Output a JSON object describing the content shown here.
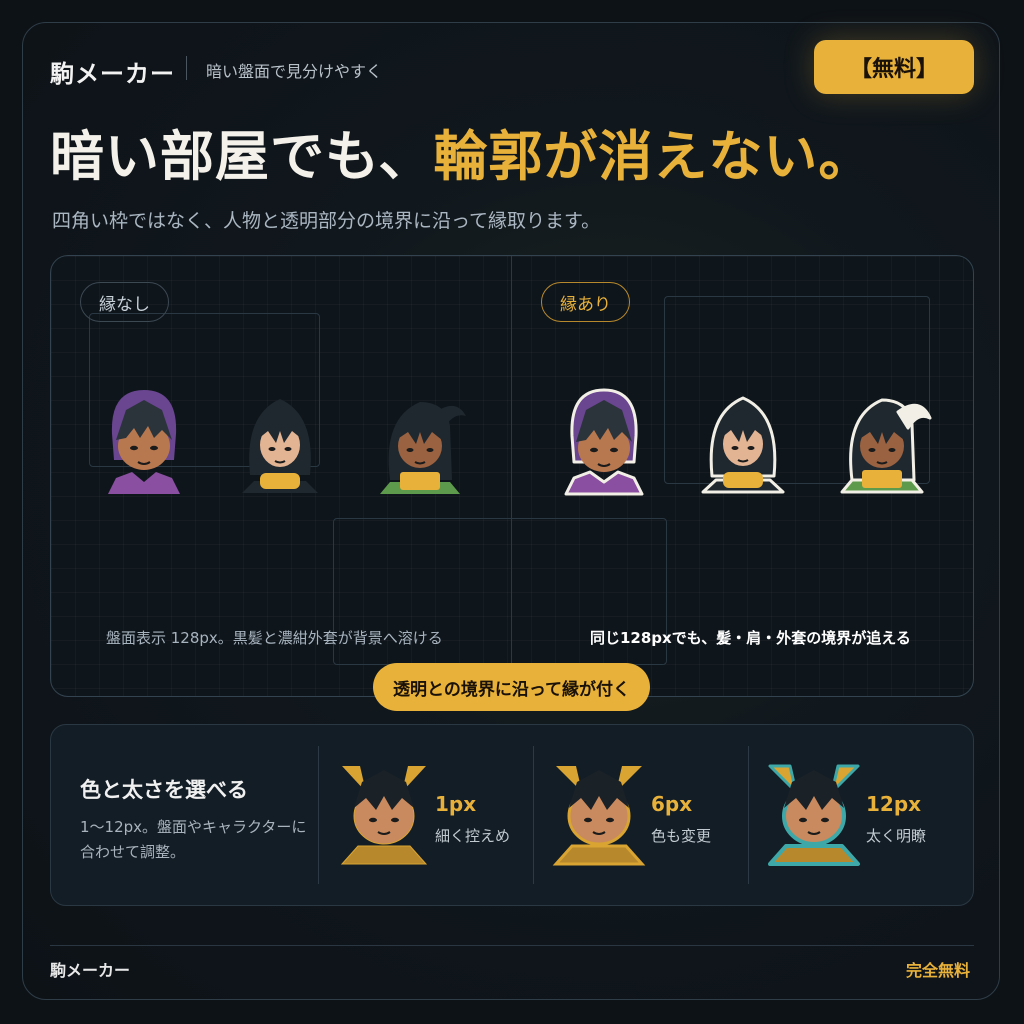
{
  "header": {
    "brand": "駒メーカー",
    "tagline": "暗い盤面で見分けやすく",
    "free_label": "【無料】"
  },
  "hero": {
    "headline_main": "暗い部屋でも、",
    "headline_accent": "輪郭が消えない。",
    "subline": "四角い枠ではなく、人物と透明部分の境界に沿って縁取ります。"
  },
  "comparison": {
    "left_label": "縁なし",
    "right_label": "縁あり",
    "left_caption": "盤面表示 128px。黒髪と濃紺外套が背景へ溶ける",
    "right_caption": "同じ128pxでも、髪・肩・外套の境界が追える",
    "action_button": "透明との境界に沿って縁が付く"
  },
  "options": {
    "title": "色と太さを選べる",
    "description": "1〜12px。盤面やキャラクターに合わせて調整。",
    "sizes": [
      {
        "label": "1px",
        "note": "細く控えめ"
      },
      {
        "label": "6px",
        "note": "色も変更"
      },
      {
        "label": "12px",
        "note": "太く明瞭"
      }
    ]
  },
  "footer": {
    "brand": "駒メーカー",
    "free": "完全無料"
  },
  "colors": {
    "accent": "#e8b13a",
    "background": "#0d1217",
    "outline_white": "#f2f0e6",
    "outline_teal": "#3ea8a8"
  }
}
